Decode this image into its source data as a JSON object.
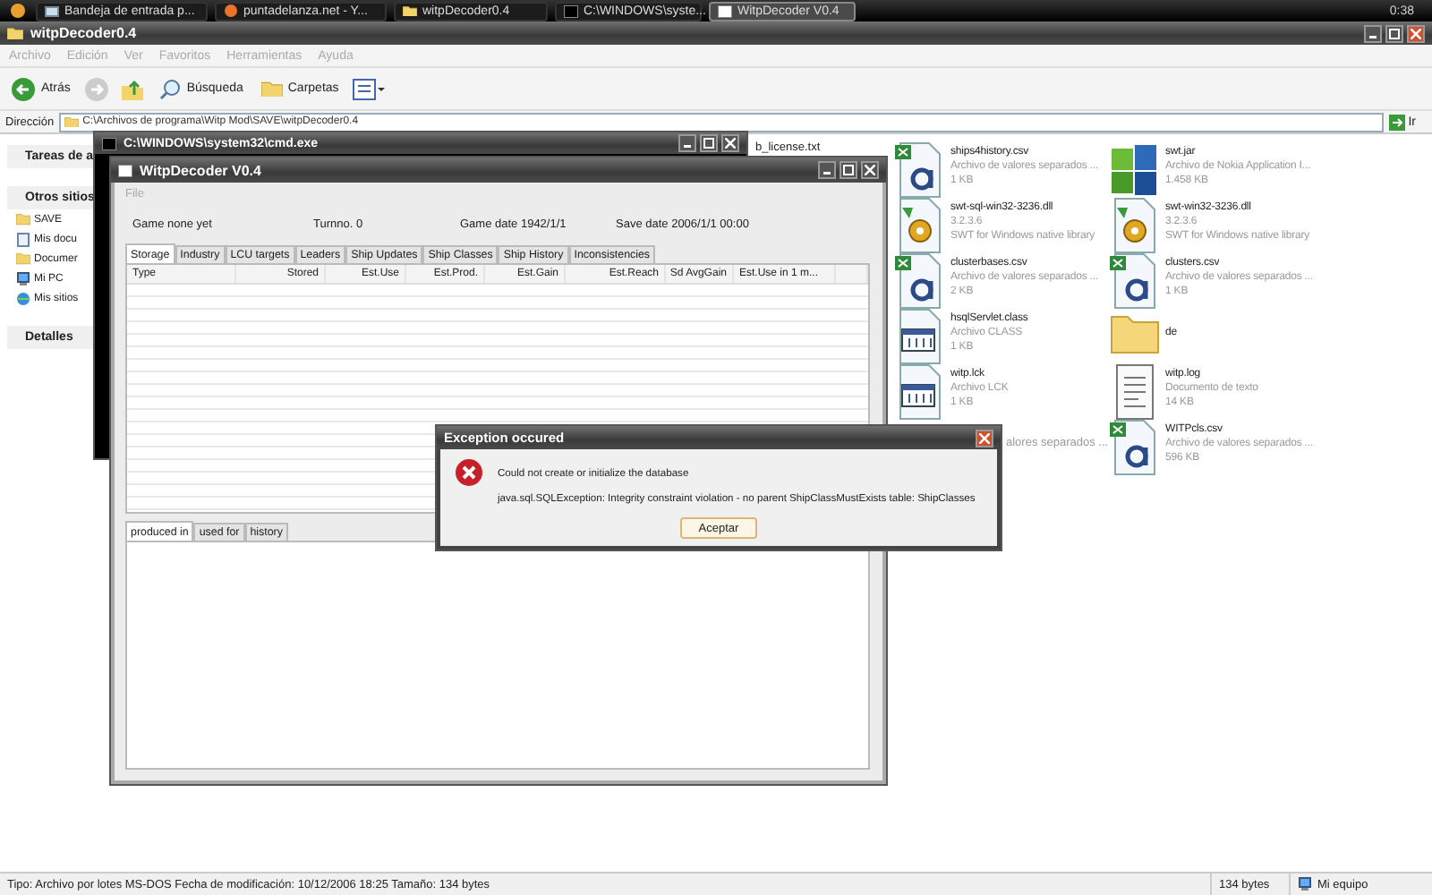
{
  "taskbar": {
    "tasks": [
      {
        "label": "Bandeja de entrada p...",
        "kind": "mail",
        "selected": false
      },
      {
        "label": "puntadelanza.net - Y...",
        "kind": "browser",
        "selected": false
      },
      {
        "label": "witpDecoder0.4",
        "kind": "folder",
        "selected": false
      },
      {
        "label": "C:\\WINDOWS\\syste...",
        "kind": "console",
        "selected": false
      },
      {
        "label": "WitpDecoder V0.4",
        "kind": "app",
        "selected": true
      }
    ],
    "clock": "0:38"
  },
  "explorer": {
    "title": "witpDecoder0.4",
    "menu": [
      "Archivo",
      "Edición",
      "Ver",
      "Favoritos",
      "Herramientas",
      "Ayuda"
    ],
    "toolbar": {
      "back": "Atrás",
      "search": "Búsqueda",
      "folders": "Carpetas"
    },
    "address": {
      "label": "Dirección",
      "value": "C:\\Archivos de programa\\Witp Mod\\SAVE\\witpDecoder0.4",
      "go": "Ir"
    },
    "sidebar": {
      "sections": [
        {
          "title": "Tareas de a"
        },
        {
          "title": "Otros sitios",
          "items": [
            {
              "label": "SAVE",
              "kind": "folder"
            },
            {
              "label": "Mis docu",
              "kind": "docs"
            },
            {
              "label": "Documer",
              "kind": "folder"
            },
            {
              "label": "Mi PC",
              "kind": "computer"
            },
            {
              "label": "Mis sitios",
              "kind": "network"
            }
          ]
        },
        {
          "title": "Detalles"
        }
      ]
    },
    "file_columns": [
      [
        {
          "name": "b_license.txt",
          "kind": "covered"
        }
      ],
      [
        {
          "name": "ships4history.csv",
          "lines": [
            "Archivo de valores separados ...",
            "1 KB"
          ],
          "kind": "csv"
        },
        {
          "name": "swt-sql-win32-3236.dll",
          "lines": [
            "3.2.3.6",
            "SWT for Windows native library"
          ],
          "kind": "dll"
        },
        {
          "name": "clusterbases.csv",
          "lines": [
            "Archivo de valores separados ...",
            "2 KB"
          ],
          "kind": "csv"
        },
        {
          "name": "hsqlServlet.class",
          "lines": [
            "Archivo CLASS",
            "1 KB"
          ],
          "kind": "class"
        },
        {
          "name": "witp.lck",
          "lines": [
            "Archivo LCK",
            "1 KB"
          ],
          "kind": "class"
        },
        {
          "lines": [
            "alores separados ..."
          ],
          "kind": "covered"
        }
      ],
      [
        {
          "name": "swt.jar",
          "lines": [
            "Archivo de Nokia Application I...",
            "1.458 KB"
          ],
          "kind": "jar"
        },
        {
          "name": "swt-win32-3236.dll",
          "lines": [
            "3.2.3.6",
            "SWT for Windows native library"
          ],
          "kind": "dll"
        },
        {
          "name": "clusters.csv",
          "lines": [
            "Archivo de valores separados ...",
            "1 KB"
          ],
          "kind": "csv"
        },
        {
          "name": "de",
          "kind": "folder"
        },
        {
          "name": "witp.log",
          "lines": [
            "Documento de texto",
            "14 KB"
          ],
          "kind": "text"
        },
        {
          "name": "WITPcls.csv",
          "lines": [
            "Archivo de valores separados ...",
            "596 KB"
          ],
          "kind": "csv"
        }
      ]
    ],
    "status_bar": {
      "info": "Tipo: Archivo por lotes MS-DOS Fecha de modificación: 10/12/2006 18:25 Tamaño: 134 bytes",
      "size": "134 bytes",
      "zone": "Mi equipo"
    }
  },
  "console": {
    "title": "C:\\WINDOWS\\system32\\cmd.exe"
  },
  "decoder": {
    "title": "WitpDecoder V0.4",
    "menu": [
      "File"
    ],
    "info": [
      "Game none yet",
      "Turnno. 0",
      "Game date 1942/1/1",
      "Save date 2006/1/1 00:00"
    ],
    "tabs": [
      {
        "label": "Storage",
        "selected": true
      },
      {
        "label": "Industry",
        "selected": false
      },
      {
        "label": "LCU targets",
        "selected": false
      },
      {
        "label": "Leaders",
        "selected": false
      },
      {
        "label": "Ship Updates",
        "selected": false
      },
      {
        "label": "Ship Classes",
        "selected": false
      },
      {
        "label": "Ship History",
        "selected": false
      },
      {
        "label": "Inconsistencies",
        "selected": false
      }
    ],
    "table": {
      "columns": [
        "Type",
        "Stored",
        "Est.Use",
        "Est.Prod.",
        "Est.Gain",
        "Est.Reach",
        "Sd AvgGain",
        "Est.Use in 1 m..."
      ]
    },
    "bottom_tabs": [
      {
        "label": "produced in",
        "selected": true
      },
      {
        "label": "used for",
        "selected": false
      },
      {
        "label": "history",
        "selected": false
      }
    ]
  },
  "dialog": {
    "title": "Exception occured",
    "message": "Could not create or initialize the database",
    "detail": "java.sql.SQLException: Integrity constraint violation - no parent ShipClassMustExists table: ShipClasses",
    "button": "Aceptar"
  }
}
